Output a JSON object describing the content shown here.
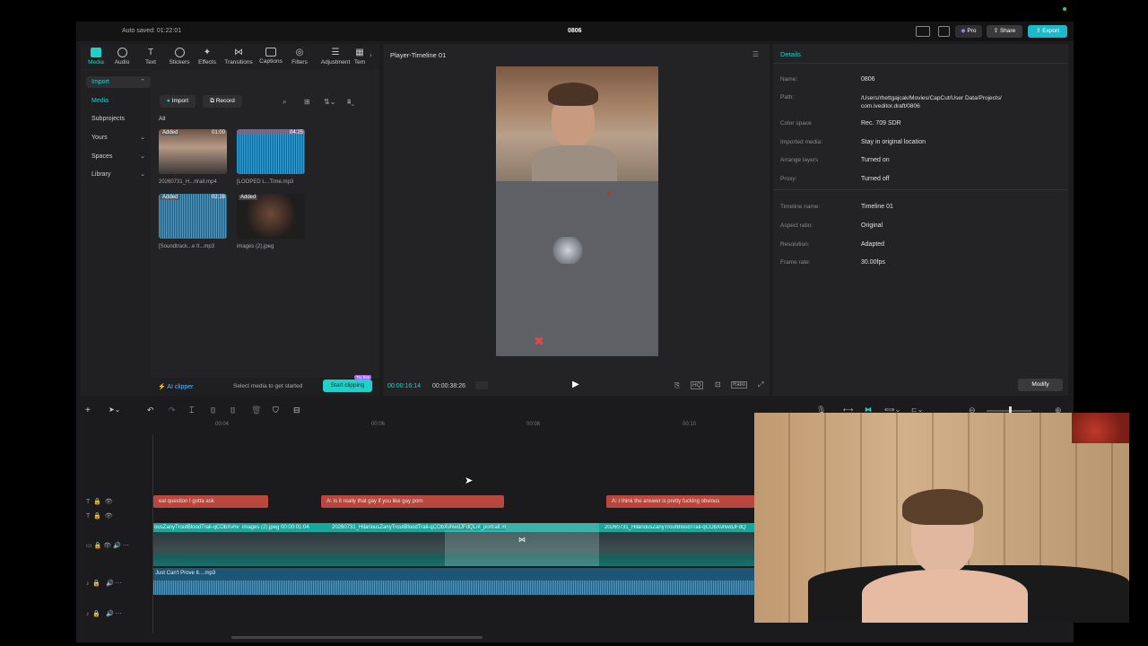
{
  "topbar": {
    "autosave": "Auto saved: 01:22:01",
    "project_title": "0806",
    "pro_label": "Pro",
    "share_label": "Share",
    "export_label": "Export"
  },
  "toolbar": [
    {
      "label": "Media"
    },
    {
      "label": "Audio"
    },
    {
      "label": "Text"
    },
    {
      "label": "Stickers"
    },
    {
      "label": "Effects"
    },
    {
      "label": "Transitions"
    },
    {
      "label": "Captions"
    },
    {
      "label": "Filters"
    },
    {
      "label": "Adjustment"
    },
    {
      "label": "Tem"
    }
  ],
  "sidebar": {
    "import": "Import",
    "media": "Media",
    "subprojects": "Subprojects",
    "yours": "Yours",
    "spaces": "Spaces",
    "library": "Library"
  },
  "media": {
    "import_btn": "Import",
    "record_btn": "Record",
    "filter_all": "All",
    "items": [
      {
        "name": "20260731_H...rtrait.mp4",
        "duration": "01:00",
        "added": "Added"
      },
      {
        "name": "[LOOPED L...Time.mp3",
        "duration": "04:25",
        "added": ""
      },
      {
        "name": "[Soundtrack...e It...mp3",
        "duration": "02:28",
        "added": "Added"
      },
      {
        "name": "images (2).jpeg",
        "duration": "",
        "added": "Added"
      }
    ],
    "ai_clipper": "AI clipper",
    "select_hint": "Select media to get started",
    "start_clipping": "Start clipping",
    "try_free": "Try free"
  },
  "player": {
    "title": "Player-Timeline 01",
    "current_time": "00:00:16:14",
    "total_time": "00:00:38:26"
  },
  "details": {
    "header": "Details",
    "rows": [
      {
        "k": "Name:",
        "v": "0806"
      },
      {
        "k": "Path:",
        "v": "/Users/rhettgajcak/Movies/CapCut/User Data/Projects/\ncom.lveditor.draft/0806"
      },
      {
        "k": "Color space",
        "v": "Rec. 709 SDR"
      },
      {
        "k": "Imported media:",
        "v": "Stay in original location"
      },
      {
        "k": "Arrange layers",
        "v": "Turned on"
      },
      {
        "k": "Proxy:",
        "v": "Turned off"
      },
      {
        "k": "Timeline name:",
        "v": "Timeline 01"
      },
      {
        "k": "Aspect ratio:",
        "v": "Original"
      },
      {
        "k": "Resolution:",
        "v": "Adapted"
      },
      {
        "k": "Frame rate:",
        "v": "30.00fps"
      }
    ],
    "modify": "Modify"
  },
  "timeline": {
    "ruler": [
      "00:04",
      "00:06",
      "00:08",
      "00:10"
    ],
    "text_clips": [
      "eal question I gotta ask",
      "Is it really that gay if you like gay porn",
      "I think the answer is pretty fucking obvious"
    ],
    "video_clips": [
      "ousZanyTroutBloodTrail-qCObXvhv",
      "images (2).jpeg  00:00:01:04",
      "20260731_HilariousZanyTroutBloodTrail-qCObXvhwdJFdQLnl_portrait.m",
      "20260731_HilariousZanyTroutBloodTrail-qCObXvhwdJFdQ"
    ],
    "audio_clip": "Just Can't Prove It....mp3"
  },
  "colors": {
    "accent": "#1fd1c9",
    "text_clip": "#b8483e",
    "audio": "#1e5f86"
  }
}
